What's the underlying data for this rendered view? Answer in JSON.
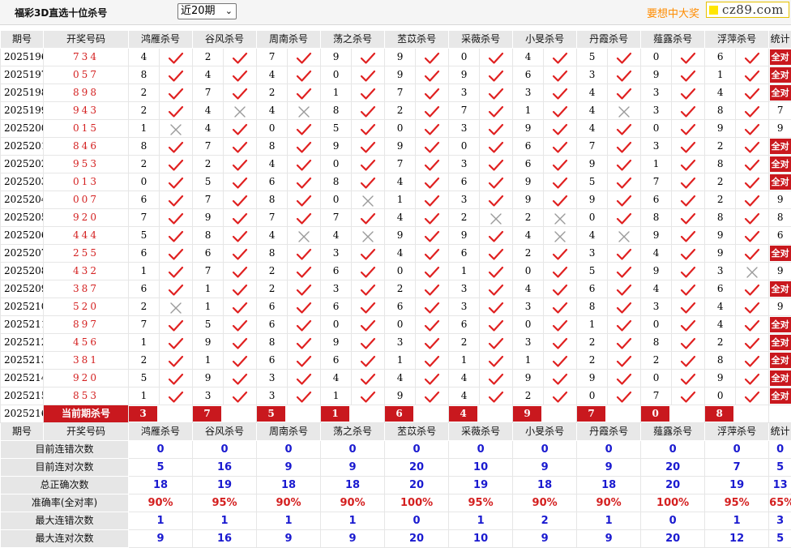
{
  "header": {
    "title": "福彩3D直选十位杀号",
    "period_select": "近20期",
    "promo": "要想中大奖",
    "logo": "cz89.com"
  },
  "columns": {
    "issue": "期号",
    "draw": "开奖号码",
    "experts": [
      "鸿雁杀号",
      "谷风杀号",
      "周南杀号",
      "荡之杀号",
      "苤苡杀号",
      "采薇杀号",
      "小旻杀号",
      "丹霞杀号",
      "薤露杀号",
      "浮萍杀号"
    ],
    "stat": "统计"
  },
  "rows": [
    {
      "issue": "2025196",
      "draw": "734",
      "kills": [
        "4",
        "2",
        "7",
        "9",
        "9",
        "0",
        "4",
        "5",
        "0",
        "6"
      ],
      "hits": [
        1,
        1,
        1,
        1,
        1,
        1,
        1,
        1,
        1,
        1
      ],
      "stat": "全对"
    },
    {
      "issue": "2025197",
      "draw": "057",
      "kills": [
        "8",
        "4",
        "4",
        "0",
        "9",
        "9",
        "6",
        "3",
        "9",
        "1"
      ],
      "hits": [
        1,
        1,
        1,
        1,
        1,
        1,
        1,
        1,
        1,
        1
      ],
      "stat": "全对"
    },
    {
      "issue": "2025198",
      "draw": "898",
      "kills": [
        "2",
        "7",
        "2",
        "1",
        "7",
        "3",
        "3",
        "4",
        "3",
        "4"
      ],
      "hits": [
        1,
        1,
        1,
        1,
        1,
        1,
        1,
        1,
        1,
        1
      ],
      "stat": "全对"
    },
    {
      "issue": "2025199",
      "draw": "943",
      "kills": [
        "2",
        "4",
        "4",
        "8",
        "2",
        "7",
        "1",
        "4",
        "3",
        "8"
      ],
      "hits": [
        1,
        0,
        0,
        1,
        1,
        1,
        1,
        0,
        1,
        1
      ],
      "stat": "7"
    },
    {
      "issue": "2025200",
      "draw": "015",
      "kills": [
        "1",
        "4",
        "0",
        "5",
        "0",
        "3",
        "9",
        "4",
        "0",
        "9"
      ],
      "hits": [
        0,
        1,
        1,
        1,
        1,
        1,
        1,
        1,
        1,
        1
      ],
      "stat": "9"
    },
    {
      "issue": "2025201",
      "draw": "846",
      "kills": [
        "8",
        "7",
        "8",
        "9",
        "9",
        "0",
        "6",
        "7",
        "3",
        "2"
      ],
      "hits": [
        1,
        1,
        1,
        1,
        1,
        1,
        1,
        1,
        1,
        1
      ],
      "stat": "全对"
    },
    {
      "issue": "2025202",
      "draw": "953",
      "kills": [
        "2",
        "2",
        "4",
        "0",
        "7",
        "3",
        "6",
        "9",
        "1",
        "8"
      ],
      "hits": [
        1,
        1,
        1,
        1,
        1,
        1,
        1,
        1,
        1,
        1
      ],
      "stat": "全对"
    },
    {
      "issue": "2025203",
      "draw": "013",
      "kills": [
        "0",
        "5",
        "6",
        "8",
        "4",
        "6",
        "9",
        "5",
        "7",
        "2"
      ],
      "hits": [
        1,
        1,
        1,
        1,
        1,
        1,
        1,
        1,
        1,
        1
      ],
      "stat": "全对"
    },
    {
      "issue": "2025204",
      "draw": "007",
      "kills": [
        "6",
        "7",
        "8",
        "0",
        "1",
        "3",
        "9",
        "9",
        "6",
        "2"
      ],
      "hits": [
        1,
        1,
        1,
        0,
        1,
        1,
        1,
        1,
        1,
        1
      ],
      "stat": "9"
    },
    {
      "issue": "2025205",
      "draw": "920",
      "kills": [
        "7",
        "9",
        "7",
        "7",
        "4",
        "2",
        "2",
        "0",
        "8",
        "8"
      ],
      "hits": [
        1,
        1,
        1,
        1,
        1,
        0,
        0,
        1,
        1,
        1
      ],
      "stat": "8"
    },
    {
      "issue": "2025206",
      "draw": "444",
      "kills": [
        "5",
        "8",
        "4",
        "4",
        "9",
        "9",
        "4",
        "4",
        "9",
        "9"
      ],
      "hits": [
        1,
        1,
        0,
        0,
        1,
        1,
        0,
        0,
        1,
        1
      ],
      "stat": "6"
    },
    {
      "issue": "2025207",
      "draw": "255",
      "kills": [
        "6",
        "6",
        "8",
        "3",
        "4",
        "6",
        "2",
        "3",
        "4",
        "9"
      ],
      "hits": [
        1,
        1,
        1,
        1,
        1,
        1,
        1,
        1,
        1,
        1
      ],
      "stat": "全对"
    },
    {
      "issue": "2025208",
      "draw": "432",
      "kills": [
        "1",
        "7",
        "2",
        "6",
        "0",
        "1",
        "0",
        "5",
        "9",
        "3"
      ],
      "hits": [
        1,
        1,
        1,
        1,
        1,
        1,
        1,
        1,
        1,
        0
      ],
      "stat": "9"
    },
    {
      "issue": "2025209",
      "draw": "387",
      "kills": [
        "6",
        "1",
        "2",
        "3",
        "2",
        "3",
        "4",
        "6",
        "4",
        "6"
      ],
      "hits": [
        1,
        1,
        1,
        1,
        1,
        1,
        1,
        1,
        1,
        1
      ],
      "stat": "全对"
    },
    {
      "issue": "2025210",
      "draw": "520",
      "kills": [
        "2",
        "1",
        "6",
        "6",
        "6",
        "3",
        "3",
        "8",
        "3",
        "4"
      ],
      "hits": [
        0,
        1,
        1,
        1,
        1,
        1,
        1,
        1,
        1,
        1
      ],
      "stat": "9"
    },
    {
      "issue": "2025211",
      "draw": "897",
      "kills": [
        "7",
        "5",
        "6",
        "0",
        "0",
        "6",
        "0",
        "1",
        "0",
        "4"
      ],
      "hits": [
        1,
        1,
        1,
        1,
        1,
        1,
        1,
        1,
        1,
        1
      ],
      "stat": "全对"
    },
    {
      "issue": "2025212",
      "draw": "456",
      "kills": [
        "1",
        "9",
        "8",
        "9",
        "3",
        "2",
        "3",
        "2",
        "8",
        "2"
      ],
      "hits": [
        1,
        1,
        1,
        1,
        1,
        1,
        1,
        1,
        1,
        1
      ],
      "stat": "全对"
    },
    {
      "issue": "2025213",
      "draw": "381",
      "kills": [
        "2",
        "1",
        "6",
        "6",
        "1",
        "1",
        "1",
        "2",
        "2",
        "8"
      ],
      "hits": [
        1,
        1,
        1,
        1,
        1,
        1,
        1,
        1,
        1,
        1
      ],
      "stat": "全对"
    },
    {
      "issue": "2025214",
      "draw": "920",
      "kills": [
        "5",
        "9",
        "3",
        "4",
        "4",
        "4",
        "9",
        "9",
        "0",
        "9"
      ],
      "hits": [
        1,
        1,
        1,
        1,
        1,
        1,
        1,
        1,
        1,
        1
      ],
      "stat": "全对"
    },
    {
      "issue": "2025215",
      "draw": "853",
      "kills": [
        "1",
        "3",
        "3",
        "1",
        "9",
        "4",
        "2",
        "0",
        "7",
        "0"
      ],
      "hits": [
        1,
        1,
        1,
        1,
        1,
        1,
        1,
        1,
        1,
        1
      ],
      "stat": "全对"
    }
  ],
  "current": {
    "issue": "2025216",
    "label": "当前期杀号",
    "kills": [
      "3",
      "7",
      "5",
      "1",
      "6",
      "4",
      "9",
      "7",
      "0",
      "8"
    ]
  },
  "summary": [
    {
      "label": "目前连错次数",
      "values": [
        "0",
        "0",
        "0",
        "0",
        "0",
        "0",
        "0",
        "0",
        "0",
        "0"
      ],
      "stat": "0",
      "color": "blue"
    },
    {
      "label": "目前连对次数",
      "values": [
        "5",
        "16",
        "9",
        "9",
        "20",
        "10",
        "9",
        "9",
        "20",
        "7"
      ],
      "stat": "5",
      "color": "blue"
    },
    {
      "label": "总正确次数",
      "values": [
        "18",
        "19",
        "18",
        "18",
        "20",
        "19",
        "18",
        "18",
        "20",
        "19"
      ],
      "stat": "13",
      "color": "blue"
    },
    {
      "label": "准确率(全对率)",
      "values": [
        "90%",
        "95%",
        "90%",
        "90%",
        "100%",
        "95%",
        "90%",
        "90%",
        "100%",
        "95%"
      ],
      "stat": "65%",
      "color": "red"
    },
    {
      "label": "最大连错次数",
      "values": [
        "1",
        "1",
        "1",
        "1",
        "0",
        "1",
        "2",
        "1",
        "0",
        "1"
      ],
      "stat": "3",
      "color": "blue"
    },
    {
      "label": "最大连对次数",
      "values": [
        "9",
        "16",
        "9",
        "9",
        "20",
        "10",
        "9",
        "9",
        "20",
        "12"
      ],
      "stat": "5",
      "color": "blue"
    }
  ],
  "colors": {
    "accent_red": "#c9181e",
    "check_red": "#e02020",
    "cross_gray": "#9a9a9a",
    "stat_blue": "#1a1ad0",
    "promo_orange": "#ff8c00"
  }
}
